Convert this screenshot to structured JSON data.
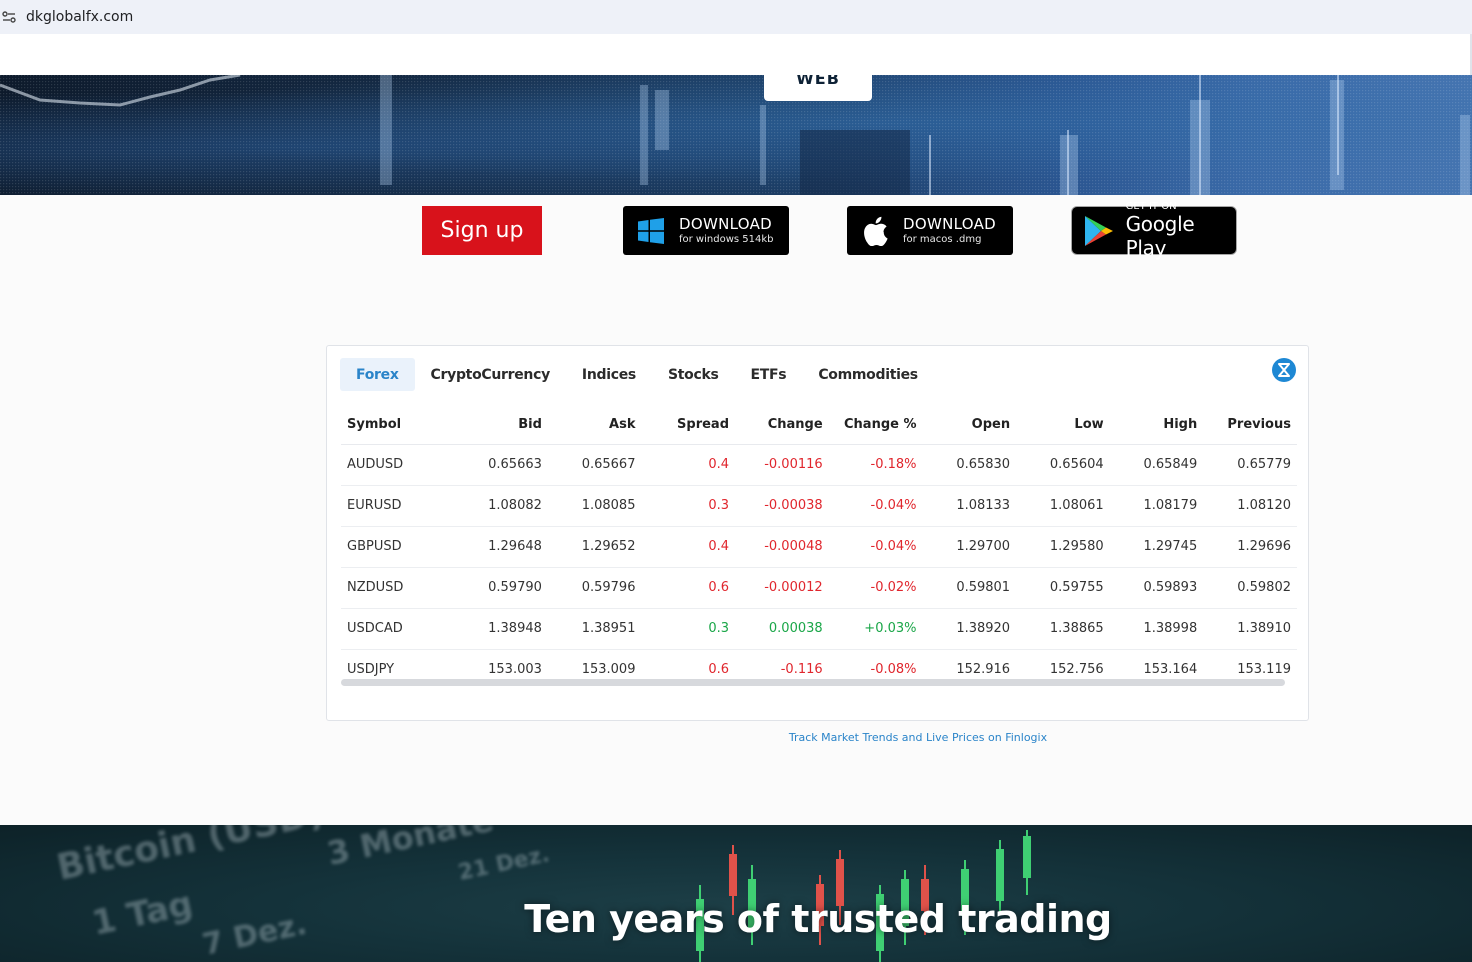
{
  "browser": {
    "url": "dkglobalfx.com"
  },
  "hero": {
    "web_label": "WEB"
  },
  "actions": {
    "signup_label": "Sign up",
    "windows": {
      "line1": "DOWNLOAD",
      "line2": "for windows 514kb"
    },
    "mac": {
      "line1": "DOWNLOAD",
      "line2": "for macos .dmg"
    },
    "google_play": {
      "line1": "GET IT ON",
      "line2": "Google Play"
    }
  },
  "widget": {
    "tabs": [
      "Forex",
      "CryptoCurrency",
      "Indices",
      "Stocks",
      "ETFs",
      "Commodities"
    ],
    "active_tab": "Forex",
    "columns": [
      "Symbol",
      "Bid",
      "Ask",
      "Spread",
      "Change",
      "Change %",
      "Open",
      "Low",
      "High",
      "Previous"
    ],
    "rows": [
      {
        "symbol": "AUDUSD",
        "bid": "0.65663",
        "ask": "0.65667",
        "spread": "0.4",
        "change": "-0.00116",
        "change_pct": "-0.18%",
        "open": "0.65830",
        "low": "0.65604",
        "high": "0.65849",
        "previous": "0.65779",
        "direction": "down"
      },
      {
        "symbol": "EURUSD",
        "bid": "1.08082",
        "ask": "1.08085",
        "spread": "0.3",
        "change": "-0.00038",
        "change_pct": "-0.04%",
        "open": "1.08133",
        "low": "1.08061",
        "high": "1.08179",
        "previous": "1.08120",
        "direction": "down"
      },
      {
        "symbol": "GBPUSD",
        "bid": "1.29648",
        "ask": "1.29652",
        "spread": "0.4",
        "change": "-0.00048",
        "change_pct": "-0.04%",
        "open": "1.29700",
        "low": "1.29580",
        "high": "1.29745",
        "previous": "1.29696",
        "direction": "down"
      },
      {
        "symbol": "NZDUSD",
        "bid": "0.59790",
        "ask": "0.59796",
        "spread": "0.6",
        "change": "-0.00012",
        "change_pct": "-0.02%",
        "open": "0.59801",
        "low": "0.59755",
        "high": "0.59893",
        "previous": "0.59802",
        "direction": "down"
      },
      {
        "symbol": "USDCAD",
        "bid": "1.38948",
        "ask": "1.38951",
        "spread": "0.3",
        "change": "0.00038",
        "change_pct": "+0.03%",
        "open": "1.38920",
        "low": "1.38865",
        "high": "1.38998",
        "previous": "1.38910",
        "direction": "up"
      },
      {
        "symbol": "USDJPY",
        "bid": "153.003",
        "ask": "153.009",
        "spread": "0.6",
        "change": "-0.116",
        "change_pct": "-0.08%",
        "open": "152.916",
        "low": "152.756",
        "high": "153.164",
        "previous": "153.119",
        "direction": "down"
      }
    ],
    "colors": {
      "negative": "#e0262d",
      "positive": "#1aa648",
      "accent": "#2a84c9"
    }
  },
  "finlogix_link": "Track Market Trends and Live Prices on Finlogix",
  "bottom": {
    "headline": "Ten years of trusted trading",
    "background_words": [
      "Bitcoin (USD)",
      "3 Monate",
      "21 Dez.",
      "1 Tag",
      "7 Dez."
    ]
  }
}
